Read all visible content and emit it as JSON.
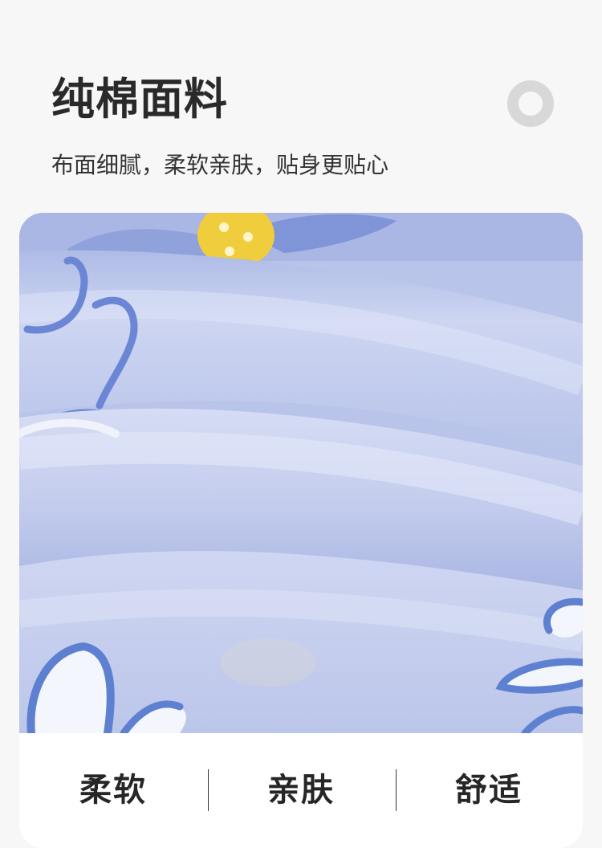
{
  "header": {
    "title": "纯棉面料",
    "subtitle": "布面细腻，柔软亲肤，贴身更贴心"
  },
  "features": [
    {
      "label": "柔软"
    },
    {
      "label": "亲肤"
    },
    {
      "label": "舒适"
    }
  ],
  "colors": {
    "page_background": "#f7f7f7",
    "fabric_base": "#c4cdec",
    "flower_outline": "#5d7fd0",
    "flower_center": "#f2cf3d",
    "ring": "#d8d8d8"
  }
}
